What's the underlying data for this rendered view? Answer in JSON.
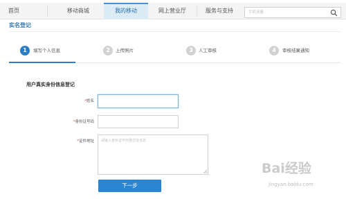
{
  "nav": {
    "items": [
      {
        "label": "首页"
      },
      {
        "label": "移动商城"
      },
      {
        "label": "我的移动"
      },
      {
        "label": "网上营业厅"
      },
      {
        "label": "服务与支持"
      }
    ],
    "active_item": "我的移动",
    "search": {
      "placeholder": "手机流量",
      "icon": "search-icon"
    }
  },
  "page": {
    "title": "实名登记"
  },
  "steps": [
    {
      "number": "1",
      "label": "填写个人信息",
      "active": true
    },
    {
      "number": "2",
      "label": "上传照片",
      "active": false
    },
    {
      "number": "3",
      "label": "人工审核",
      "active": false
    },
    {
      "number": "4",
      "label": "审核结果通知",
      "active": false
    }
  ],
  "form": {
    "title": "用户真实身份信息登记",
    "required_mark": "*",
    "name_label": "姓名",
    "id_label": "身份证号码",
    "address_label": "证件地址",
    "name_value": "",
    "id_value": "",
    "address_placeholder": "请输入身份证中完整住址信息",
    "next_button": "下一步"
  },
  "watermark": {
    "text": "Bai经验",
    "url": "jingyan.baidu.com"
  },
  "colors": {
    "accent": "#2a7cc7",
    "button": "#2a86d0",
    "required": "#e0483d",
    "title": "#2f7bbf"
  }
}
